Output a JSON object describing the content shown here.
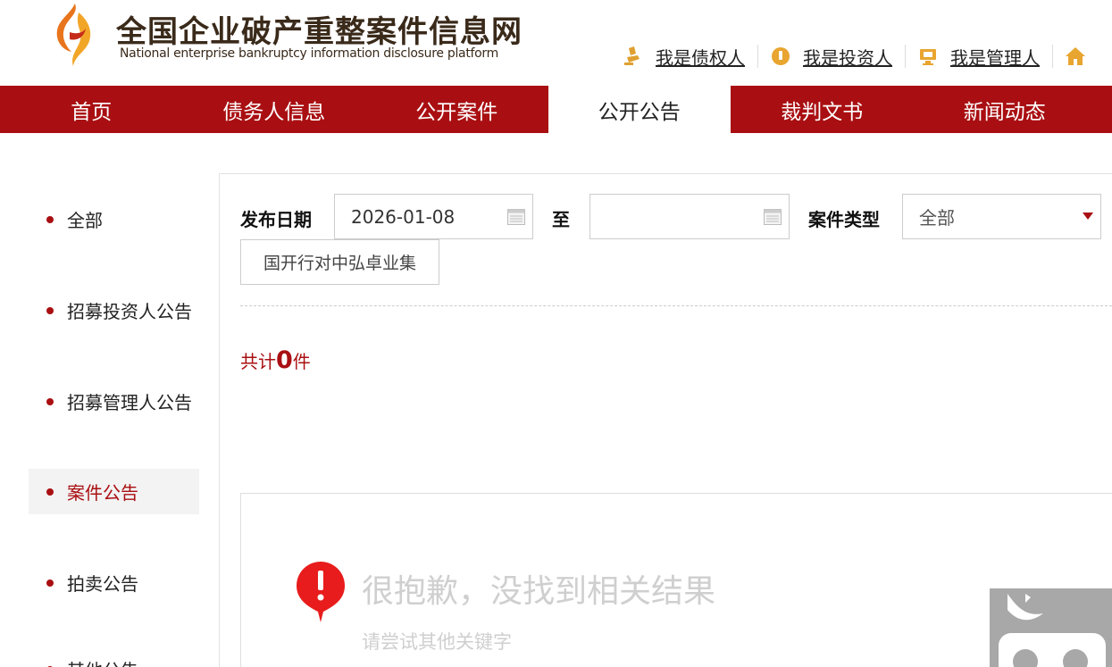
{
  "header": {
    "title": "全国企业破产重整案件信息网",
    "subtitle": "National enterprise bankruptcy  information disclosure platform",
    "user_links": [
      {
        "label": "我是债权人",
        "icon": "creditor-icon"
      },
      {
        "label": "我是投资人",
        "icon": "investor-icon"
      },
      {
        "label": "我是管理人",
        "icon": "administrator-icon"
      }
    ],
    "home_icon": "home-icon"
  },
  "nav": {
    "items": [
      "首页",
      "债务人信息",
      "公开案件",
      "公开公告",
      "裁判文书",
      "新闻动态"
    ],
    "active_index": 3
  },
  "sidebar": {
    "items": [
      "全部",
      "招募投资人公告",
      "招募管理人公告",
      "案件公告",
      "拍卖公告",
      "其他公告"
    ],
    "active_index": 3
  },
  "filter": {
    "date_label": "发布日期",
    "date_from": "2026-01-08",
    "to_label": "至",
    "date_to": "",
    "type_label": "案件类型",
    "type_value": "全部",
    "keyword": "国开行对中弘卓业集"
  },
  "results": {
    "count_prefix": "共计",
    "count": "0",
    "count_suffix": "件",
    "empty_title": "很抱歉，没找到相关结果",
    "empty_subtitle": "请尝试其他关键字"
  },
  "colors": {
    "brand_red": "#a90f12",
    "nav_active_bg": "#ffffff",
    "empty_text": "#cfcfcf"
  }
}
